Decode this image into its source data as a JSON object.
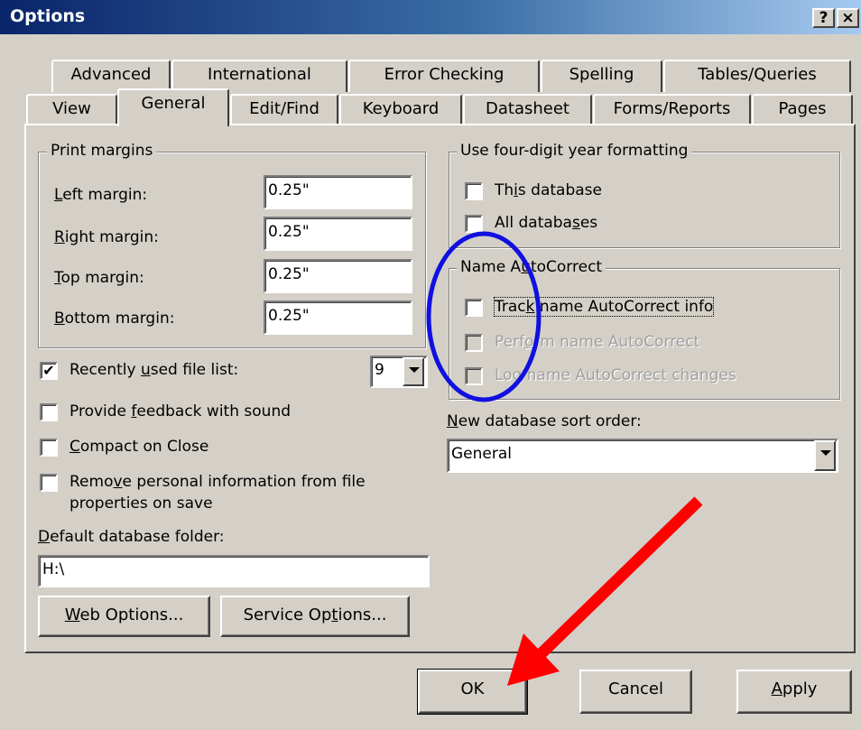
{
  "window": {
    "title": "Options",
    "help_btn": "?",
    "close_btn": "×"
  },
  "tabs_row1": [
    "Advanced",
    "International",
    "Error Checking",
    "Spelling",
    "Tables/Queries"
  ],
  "tabs_row2": [
    "View",
    "General",
    "Edit/Find",
    "Keyboard",
    "Datasheet",
    "Forms/Reports",
    "Pages"
  ],
  "selected_tab": "General",
  "print_margins": {
    "legend": "Print margins",
    "left_label_u": "L",
    "left_label_rest": "eft margin:",
    "left_value": "0.25\"",
    "right_label_u": "R",
    "right_label_rest": "ight margin:",
    "right_value": "0.25\"",
    "top_label_u": "T",
    "top_label_rest": "op margin:",
    "top_value": "0.25\"",
    "bottom_label_u": "B",
    "bottom_label_rest": "ottom margin:",
    "bottom_value": "0.25\""
  },
  "recent_files": {
    "pre": "Recently ",
    "u": "u",
    "post": "sed file list:",
    "checked": "✔",
    "count": "9"
  },
  "feedback_sound": {
    "pre": "Provide ",
    "u": "f",
    "post": "eedback with sound"
  },
  "compact_on_close": {
    "u": "C",
    "post": "ompact on Close"
  },
  "remove_personal": {
    "line1_pre": "Remo",
    "line1_u": "v",
    "line1_post": "e personal information from file",
    "line2": "properties on save"
  },
  "default_folder": {
    "u": "D",
    "post": "efault database folder:",
    "value": "H:\\"
  },
  "web_options": {
    "u": "W",
    "post": "eb Options..."
  },
  "service_options": {
    "pre": "Service Op",
    "u": "t",
    "post": "ions..."
  },
  "four_digit": {
    "legend": "Use four-digit year formatting",
    "this_db_pre": "Th",
    "this_db_u": "i",
    "this_db_post": "s database",
    "all_db_pre": "All databa",
    "all_db_u": "s",
    "all_db_post": "es"
  },
  "autocorrect": {
    "legend_pre": "Name A",
    "legend_u": "u",
    "legend_post": "toCorrect",
    "track_pre": "Trac",
    "track_u": "k",
    "track_post": " name AutoCorrect info",
    "perform_pre": "Perf",
    "perform_u": "o",
    "perform_post": "rm name AutoCorrect",
    "log_pre": "Lo",
    "log_u": "g",
    "log_post": " name AutoCorrect changes"
  },
  "sort_order": {
    "u": "N",
    "post": "ew database sort order:",
    "value": "General"
  },
  "buttons": {
    "ok": "OK",
    "cancel": "Cancel",
    "apply_u": "A",
    "apply_post": "pply"
  },
  "annotations": {
    "circle_color": "#1010e0",
    "arrow_color": "#ff0000"
  }
}
